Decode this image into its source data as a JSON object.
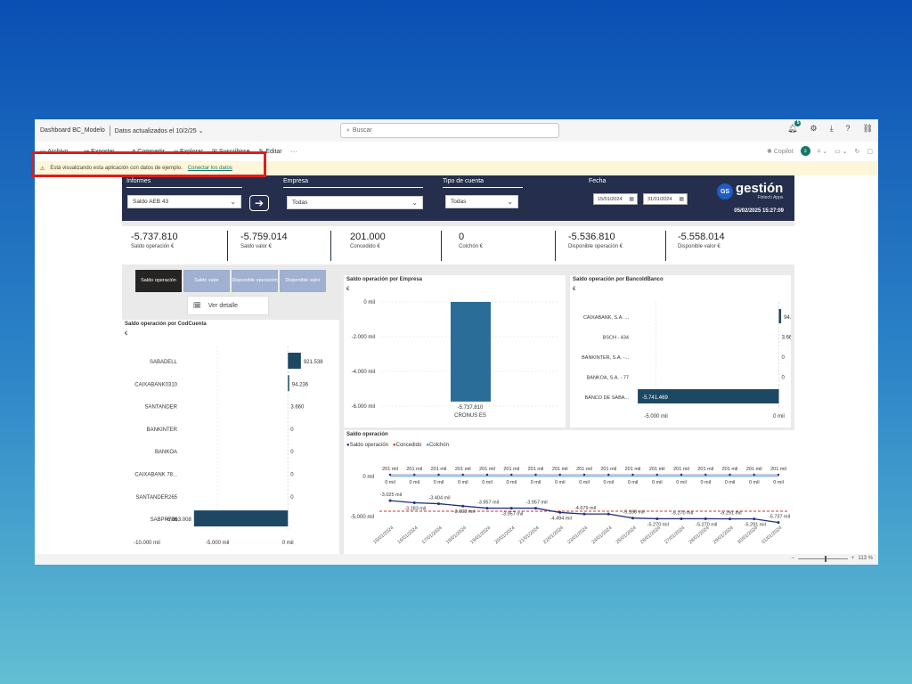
{
  "window": {
    "title": "Dashboard BC_Modelo",
    "updated": "Datos actualizados el 10/2/25",
    "search_placeholder": "Buscar",
    "notif_count": "5",
    "icons": [
      "bell-icon",
      "settings-icon",
      "download-icon",
      "help-icon",
      "share-icon"
    ]
  },
  "actions": {
    "file": "Archivo",
    "export": "Exportar",
    "share": "Compartir",
    "explore": "Explorar",
    "subscribe": "Suscribirse",
    "edit": "Editar",
    "more": "···",
    "copilot": "Copilot"
  },
  "banner": {
    "text": "Está visualizando esta aplicación con datos de ejemplo.",
    "link": "Conectar los datos"
  },
  "header": {
    "informes_label": "Informes",
    "informes_value": "Saldo AEB 43",
    "empresa_label": "Empresa",
    "empresa_value": "Todas",
    "tipo_label": "Tipo de cuenta",
    "tipo_value": "Todas",
    "fecha_label": "Fecha",
    "fecha_from": "15/01/2024",
    "fecha_to": "31/01/2024",
    "logo_initials": "GS",
    "logo_word": "gestión",
    "logo_sub": "Fintech Apps",
    "timestamp": "05/02/2025 15:27:09"
  },
  "kpis": [
    {
      "value": "-5.737.810",
      "label": "Saldo operación €"
    },
    {
      "value": "-5.759.014",
      "label": "Saldo valor €"
    },
    {
      "value": "201.000",
      "label": "Concedido €"
    },
    {
      "value": "0",
      "label": "Colchón €"
    },
    {
      "value": "-5.536.810",
      "label": "Disponible operación €"
    },
    {
      "value": "-5.558.014",
      "label": "Disponible valor €"
    }
  ],
  "tabs": [
    "Saldo operación",
    "Saldo valor",
    "Disponible operación",
    "Disponible valor"
  ],
  "ver_detalle": "Ver detalle",
  "status": {
    "zoom": "113 %"
  },
  "chart_data": [
    {
      "type": "bar",
      "orientation": "horizontal",
      "title": "Saldo operación por CodCuenta",
      "unit": "€",
      "categories": [
        "SABADELL",
        "CAIXABANK0310",
        "SANTANDER",
        "BANKINTER",
        "BANKOA",
        "CAIXABANK 78...",
        "SANTANDER265",
        "SABPR706"
      ],
      "values": [
        921538,
        94236,
        3660,
        0,
        0,
        0,
        0,
        -6663008
      ],
      "labels": [
        "921.538",
        "94.236",
        "3.660",
        "0",
        "0",
        "0",
        "0",
        "-6.663.008"
      ],
      "ticks": [
        "-10.000 mil",
        "-5.000 mil",
        "0 mil"
      ],
      "xlim": [
        -10000000,
        1500000
      ],
      "color": "#1d4863"
    },
    {
      "type": "bar",
      "title": "Saldo operación por Empresa",
      "unit": "€",
      "categories": [
        "CRONUS ES"
      ],
      "values": [
        -5737810
      ],
      "labels": [
        "-5.737.810"
      ],
      "ticks": [
        "0 mil",
        "-2.000 mil",
        "-4.000 mil",
        "-6.000 mil"
      ],
      "ylim": [
        -6000000,
        0
      ],
      "color": "#2a6d99"
    },
    {
      "type": "bar",
      "orientation": "horizontal",
      "title": "Saldo operación por BancoIdBanco",
      "unit": "€",
      "categories": [
        "CAIXABANK, S.A. ...",
        "BSCH - 434",
        "BANKINTER, S.A. -...",
        "BANKOA, S.A. - 77",
        "BANCO DE SABA..."
      ],
      "values": [
        94236,
        3660,
        0,
        0,
        -5741469
      ],
      "labels": [
        "94.236",
        "3.660",
        "0",
        "0",
        "-5.741.469"
      ],
      "ticks": [
        "-5.000 mil",
        "0 mil"
      ],
      "xlim": [
        -8500000,
        200000
      ],
      "color": "#1d4863"
    },
    {
      "type": "line",
      "title": "Saldo operación",
      "legend": [
        {
          "name": "Saldo operación",
          "color": "#24307a"
        },
        {
          "name": "Concedido",
          "color": "#d42c2c"
        },
        {
          "name": "Colchón",
          "color": "#3c8fd6"
        }
      ],
      "x": [
        "15/01/2024",
        "16/01/2024",
        "17/01/2024",
        "18/01/2024",
        "19/01/2024",
        "20/01/2024",
        "21/01/2024",
        "22/01/2024",
        "23/01/2024",
        "24/01/2024",
        "25/01/2024",
        "26/01/2024",
        "27/01/2024",
        "28/01/2024",
        "29/01/2024",
        "30/01/2024",
        "31/01/2024"
      ],
      "series": [
        {
          "name": "Saldo operación",
          "values": [
            -3025,
            -3283,
            -3404,
            -3693,
            -3957,
            -3957,
            -3957,
            -4494,
            -4679,
            -4679,
            -5188,
            -5270,
            -5270,
            -5270,
            -5291,
            -5291,
            -5737
          ],
          "labels": [
            "-3.025 mil",
            "-3.283 mil",
            "-3.404 mil",
            "-3.693 mil",
            "-3.957 mil",
            "-3.957 mil",
            "-3.957 mil",
            "-4.494 mil",
            "-4.679 mil",
            "",
            "-5.188 mil",
            "-5.270 mil",
            "-5.270 mil",
            "-5.270 mil",
            "-5.291 mil",
            "-5.291 mil",
            "-5.737 mil"
          ]
        },
        {
          "name": "Concedido",
          "values": [
            201,
            201,
            201,
            201,
            201,
            201,
            201,
            201,
            201,
            201,
            201,
            201,
            201,
            201,
            201,
            201,
            201
          ],
          "label": "201 mil"
        },
        {
          "name": "Colchón",
          "values": [
            0,
            0,
            0,
            0,
            0,
            0,
            0,
            0,
            0,
            0,
            0,
            0,
            0,
            0,
            0,
            0,
            0
          ],
          "label": "0 mil"
        }
      ],
      "ticks": [
        "0 mil",
        "-5.000 mil"
      ],
      "reference_line": -5000
    }
  ]
}
